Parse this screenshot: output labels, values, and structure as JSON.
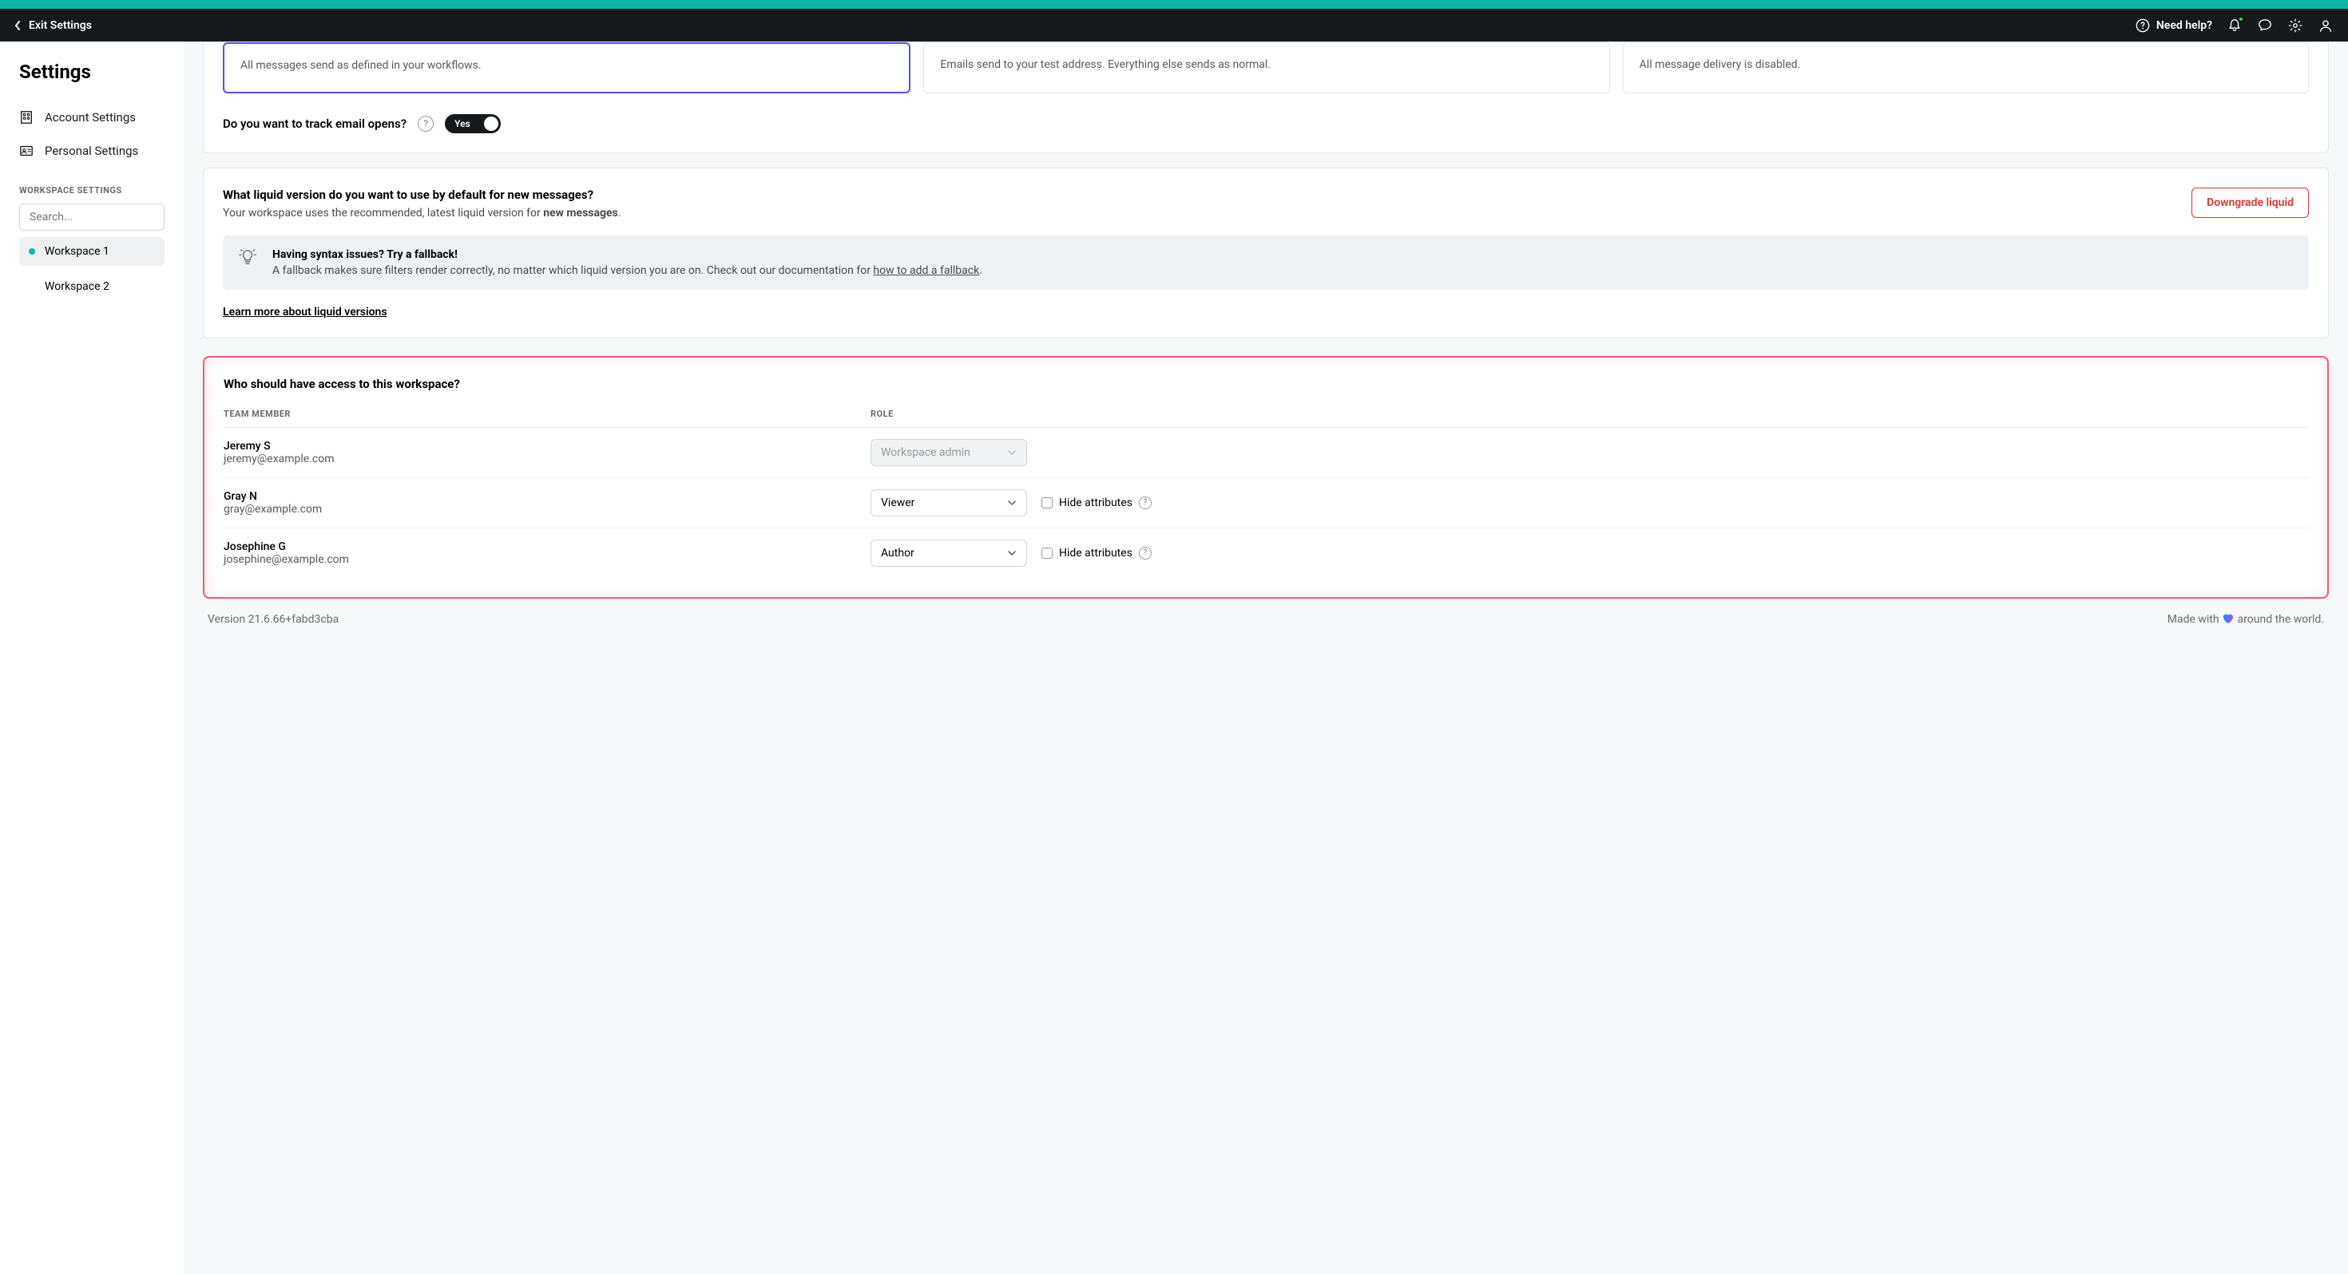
{
  "nav": {
    "exit_label": "Exit Settings",
    "need_help": "Need help?"
  },
  "sidebar": {
    "title": "Settings",
    "account": "Account Settings",
    "personal": "Personal Settings",
    "section_label": "WORKSPACE SETTINGS",
    "search_placeholder": "Search...",
    "workspaces": [
      {
        "label": "Workspace 1",
        "active": true
      },
      {
        "label": "Workspace 2",
        "active": false
      }
    ]
  },
  "delivery": {
    "options": [
      {
        "desc": "All messages send as defined in your workflows."
      },
      {
        "desc": "Emails send to your test address. Everything else sends as normal."
      },
      {
        "desc": "All message delivery is disabled."
      }
    ],
    "track_label": "Do you want to track email opens?",
    "toggle_label": "Yes"
  },
  "liquid": {
    "title": "What liquid version do you want to use by default for new messages?",
    "sub_prefix": "Your workspace uses the recommended, latest liquid version for ",
    "sub_bold": "new messages",
    "sub_suffix": ".",
    "downgrade": "Downgrade liquid",
    "tip_title": "Having syntax issues? Try a fallback!",
    "tip_text_prefix": "A fallback makes sure filters render correctly, no matter which liquid version you are on. Check out our documentation for ",
    "tip_link": "how to add a fallback",
    "tip_text_suffix": ".",
    "learn_link": "Learn more about liquid versions"
  },
  "access": {
    "title": "Who should have access to this workspace?",
    "col_member": "TEAM MEMBER",
    "col_role": "ROLE",
    "hide_label": "Hide attributes",
    "members": [
      {
        "name": "Jeremy S",
        "email": "jeremy@example.com",
        "role": "Workspace admin",
        "disabled": true,
        "hide_option": false
      },
      {
        "name": "Gray N",
        "email": "gray@example.com",
        "role": "Viewer",
        "disabled": false,
        "hide_option": true
      },
      {
        "name": "Josephine G",
        "email": "josephine@example.com",
        "role": "Author",
        "disabled": false,
        "hide_option": true
      }
    ]
  },
  "footer": {
    "version": "Version 21.6.66+fabd3cba",
    "made_prefix": "Made with ",
    "made_suffix": " around the world."
  }
}
